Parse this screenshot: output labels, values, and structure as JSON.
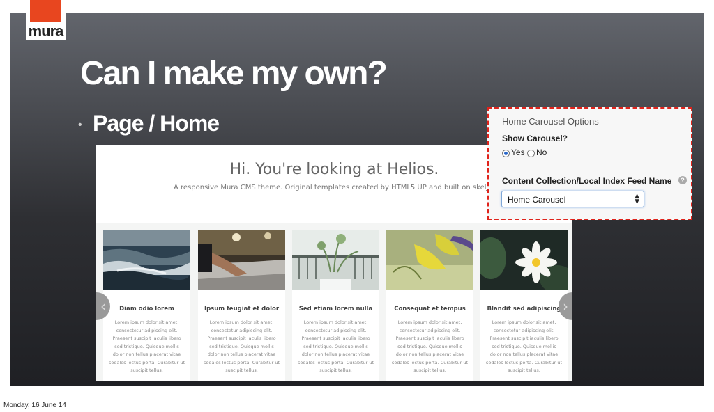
{
  "logo": {
    "text": "mura"
  },
  "slide": {
    "title": "Can I make my own?",
    "bullet": "Page / Home"
  },
  "site": {
    "heading": "Hi. You're looking at Helios.",
    "subheading": "A responsive Mura CMS theme. Original templates created by HTML5 UP and built on skelJS.",
    "cards": [
      {
        "title": "Diam odio lorem",
        "body": "Lorem ipsum dolor sit amet, consectetur adipiscing elit. Praesent suscipit iaculis libero sed tristique. Quisque mollis dolor non tellus placerat vitae sodales lectus porta. Curabitur ut suscipit tellus.",
        "image": "ocean-waves-photo"
      },
      {
        "title": "Ipsum feugiat et dolor",
        "body": "Lorem ipsum dolor sit amet, consectetur adipiscing elit. Praesent suscipit iaculis libero sed tristique. Quisque mollis dolor non tellus placerat vitae sodales lectus porta. Curabitur ut suscipit tellus.",
        "image": "mixing-console-photo"
      },
      {
        "title": "Sed etiam lorem nulla",
        "body": "Lorem ipsum dolor sit amet, consectetur adipiscing elit. Praesent suscipit iaculis libero sed tristique. Quisque mollis dolor non tellus placerat vitae sodales lectus porta. Curabitur ut suscipit tellus.",
        "image": "window-plant-photo"
      },
      {
        "title": "Consequat et tempus",
        "body": "Lorem ipsum dolor sit amet, consectetur adipiscing elit. Praesent suscipit iaculis libero sed tristique. Quisque mollis dolor non tellus placerat vitae sodales lectus porta. Curabitur ut suscipit tellus.",
        "image": "yellow-leaves-photo"
      },
      {
        "title": "Blandit sed adipiscing",
        "body": "Lorem ipsum dolor sit amet, consectetur adipiscing elit. Praesent suscipit iaculis libero sed tristique. Quisque mollis dolor non tellus placerat vitae sodales lectus porta. Curabitur ut suscipit tellus.",
        "image": "water-lily-photo"
      }
    ],
    "prev_icon": "chevron-left-icon",
    "next_icon": "chevron-right-icon"
  },
  "panel": {
    "title": "Home Carousel Options",
    "show_label": "Show Carousel?",
    "yes_label": "Yes",
    "no_label": "No",
    "selected": "Yes",
    "feed_label": "Content Collection/Local Index Feed Name",
    "help_icon": "help-icon",
    "feed_value": "Home Carousel"
  },
  "footer": {
    "date": "Monday, 16 June 14"
  },
  "colors": {
    "brand": "#e8461f",
    "dashed_border": "#e0231b",
    "radio_selected": "#2a68c9"
  }
}
